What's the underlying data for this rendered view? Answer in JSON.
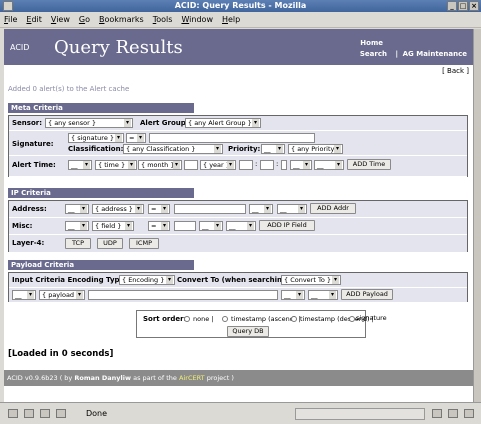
{
  "window": {
    "title": "ACID: Query Results - Mozilla"
  },
  "menu": [
    "File",
    "Edit",
    "View",
    "Go",
    "Bookmarks",
    "Tools",
    "Window",
    "Help"
  ],
  "header": {
    "logo": "ACID",
    "title": "Query Results",
    "nav_home": "Home",
    "nav_search": "Search",
    "nav_sep": "|",
    "nav_ag": "AG Maintenance"
  },
  "back_link": "[ Back ]",
  "cache_msg": "Added 0 alert(s) to the Alert cache",
  "meta": {
    "heading": "Meta Criteria",
    "sensor_label": "Sensor:",
    "sensor_value": "{ any sensor }",
    "alert_group_label": "Alert Group:",
    "alert_group_value": "{ any Alert Group }",
    "signature_label": "Signature:",
    "signature_value": "{ signature }",
    "sig_op": "=",
    "classification_label": "Classification:",
    "classification_value": "{ any Classification }",
    "priority_label": "Priority:",
    "priority_op": "__",
    "priority_value": "{ any Priority }",
    "alert_time_label": "Alert Time:",
    "t1": "__",
    "t2": "{ time }",
    "t3": "{ month }",
    "t5": "{ year }",
    "colon": ":",
    "t10": "__",
    "t11": "__",
    "add_time": "ADD Time"
  },
  "ip": {
    "heading": "IP Criteria",
    "address_label": "Address:",
    "a1": "__",
    "a2": "{ address }",
    "a3": "=",
    "a5": "__",
    "a6": "__",
    "add_addr": "ADD Addr",
    "misc_label": "Misc:",
    "m1": "__",
    "m2": "{ field }",
    "m3": "=",
    "m5": "__",
    "m6": "__",
    "add_field": "ADD IP Field",
    "layer4_label": "Layer-4:",
    "tcp": "TCP",
    "udp": "UDP",
    "icmp": "ICMP"
  },
  "payload": {
    "heading": "Payload Criteria",
    "enc_label": "Input Criteria Encoding Type:",
    "enc_value": "{ Encoding }",
    "conv_label": "Convert To (when searching):",
    "conv_value": "{ Convert To }",
    "p1": "__",
    "p2": "{ payload }",
    "p4": "__",
    "p5": "__",
    "add_payload": "ADD Payload"
  },
  "sort": {
    "label": "Sort order:",
    "none": "none |",
    "ts_asc": "timestamp (ascend) |",
    "ts_desc": "timestamp (descend) |",
    "sig": "signature",
    "query": "Query DB"
  },
  "loaded": "[Loaded in 0 seconds]",
  "footer": {
    "prefix": "ACID v0.9.6b23 ( by",
    "author": "Roman Danyliw",
    "mid": "as part of the",
    "project": "AirCERT",
    "suffix": "project )"
  },
  "status": {
    "text": "Done"
  }
}
